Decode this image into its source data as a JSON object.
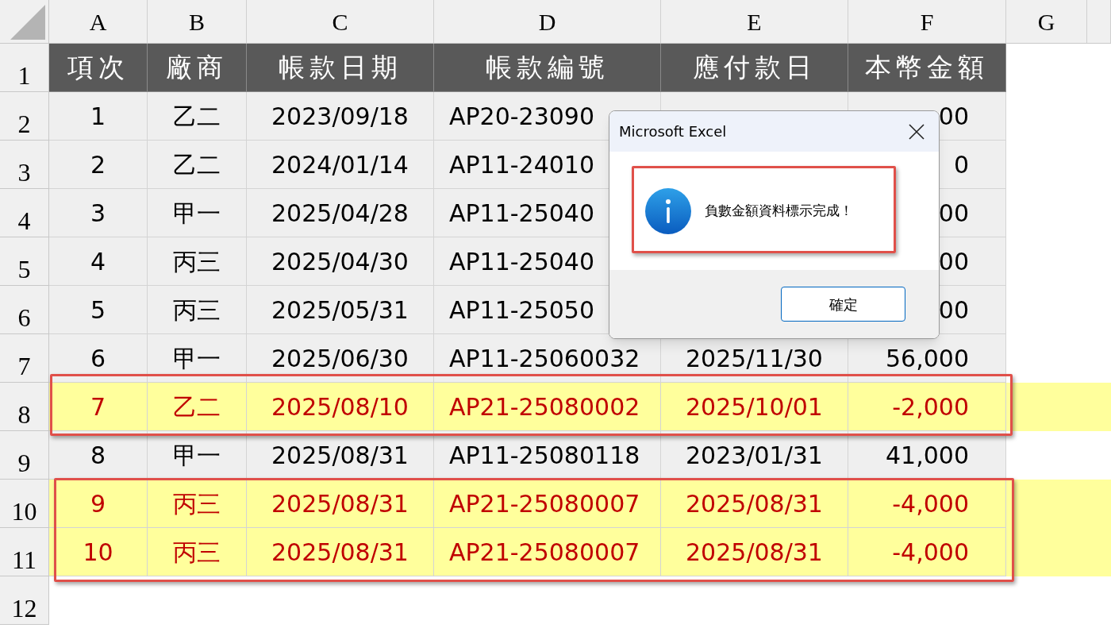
{
  "column_headers": [
    "A",
    "B",
    "C",
    "D",
    "E",
    "F",
    "G"
  ],
  "row_headers": [
    "1",
    "2",
    "3",
    "4",
    "5",
    "6",
    "7",
    "8",
    "9",
    "10",
    "11",
    "12"
  ],
  "table": {
    "columns": [
      "項次",
      "廠商",
      "帳款日期",
      "帳款編號",
      "應付款日",
      "本幣金額"
    ],
    "rows": [
      {
        "cells": [
          "1",
          "乙二",
          "2023/09/18",
          "AP20-23090",
          null,
          "00"
        ],
        "highlighted": false
      },
      {
        "cells": [
          "2",
          "乙二",
          "2024/01/14",
          "AP11-24010",
          null,
          "0"
        ],
        "highlighted": false
      },
      {
        "cells": [
          "3",
          "甲一",
          "2025/04/28",
          "AP11-25040",
          null,
          "00"
        ],
        "highlighted": false
      },
      {
        "cells": [
          "4",
          "丙三",
          "2025/04/30",
          "AP11-25040",
          null,
          "00"
        ],
        "highlighted": false
      },
      {
        "cells": [
          "5",
          "丙三",
          "2025/05/31",
          "AP11-25050",
          null,
          "00"
        ],
        "highlighted": false
      },
      {
        "cells": [
          "6",
          "甲一",
          "2025/06/30",
          "AP11-25060032",
          "2025/11/30",
          "56,000"
        ],
        "highlighted": false
      },
      {
        "cells": [
          "7",
          "乙二",
          "2025/08/10",
          "AP21-25080002",
          "2025/10/01",
          "-2,000"
        ],
        "highlighted": true
      },
      {
        "cells": [
          "8",
          "甲一",
          "2025/08/31",
          "AP11-25080118",
          "2023/01/31",
          "41,000"
        ],
        "highlighted": false
      },
      {
        "cells": [
          "9",
          "丙三",
          "2025/08/31",
          "AP21-25080007",
          "2025/08/31",
          "-4,000"
        ],
        "highlighted": true
      },
      {
        "cells": [
          "10",
          "丙三",
          "2025/08/31",
          "AP21-25080007",
          "2025/08/31",
          "-4,000"
        ],
        "highlighted": true
      }
    ]
  },
  "dialog": {
    "title": "Microsoft Excel",
    "message": "負數金額資料標示完成！",
    "button": "確定"
  }
}
